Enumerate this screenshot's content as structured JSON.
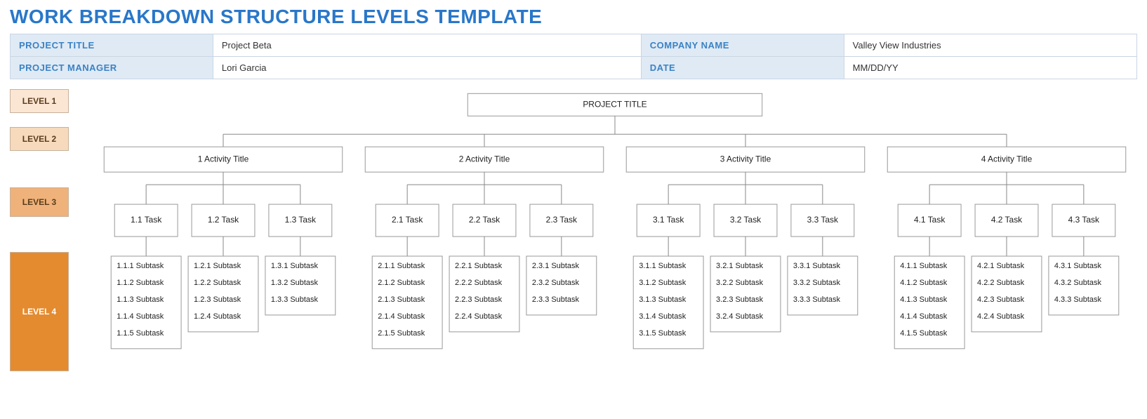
{
  "title": "WORK BREAKDOWN STRUCTURE LEVELS TEMPLATE",
  "info": {
    "project_title_label": "PROJECT TITLE",
    "project_title_value": "Project Beta",
    "company_name_label": "COMPANY NAME",
    "company_name_value": "Valley View Industries",
    "project_manager_label": "PROJECT MANAGER",
    "project_manager_value": "Lori Garcia",
    "date_label": "DATE",
    "date_value": "MM/DD/YY"
  },
  "levels": {
    "l1": "LEVEL 1",
    "l2": "LEVEL 2",
    "l3": "LEVEL 3",
    "l4": "LEVEL 4"
  },
  "root": "PROJECT TITLE",
  "activities": [
    {
      "label": "1 Activity Title",
      "tasks": [
        {
          "label": "1.1 Task",
          "subs": [
            "1.1.1 Subtask",
            "1.1.2 Subtask",
            "1.1.3 Subtask",
            "1.1.4 Subtask",
            "1.1.5 Subtask"
          ]
        },
        {
          "label": "1.2 Task",
          "subs": [
            "1.2.1 Subtask",
            "1.2.2 Subtask",
            "1.2.3 Subtask",
            "1.2.4 Subtask"
          ]
        },
        {
          "label": "1.3 Task",
          "subs": [
            "1.3.1 Subtask",
            "1.3.2 Subtask",
            "1.3.3 Subtask"
          ]
        }
      ]
    },
    {
      "label": "2 Activity Title",
      "tasks": [
        {
          "label": "2.1 Task",
          "subs": [
            "2.1.1 Subtask",
            "2.1.2 Subtask",
            "2.1.3 Subtask",
            "2.1.4 Subtask",
            "2.1.5 Subtask"
          ]
        },
        {
          "label": "2.2 Task",
          "subs": [
            "2.2.1 Subtask",
            "2.2.2 Subtask",
            "2.2.3 Subtask",
            "2.2.4 Subtask"
          ]
        },
        {
          "label": "2.3 Task",
          "subs": [
            "2.3.1 Subtask",
            "2.3.2 Subtask",
            "2.3.3 Subtask"
          ]
        }
      ]
    },
    {
      "label": "3 Activity Title",
      "tasks": [
        {
          "label": "3.1 Task",
          "subs": [
            "3.1.1 Subtask",
            "3.1.2 Subtask",
            "3.1.3 Subtask",
            "3.1.4 Subtask",
            "3.1.5 Subtask"
          ]
        },
        {
          "label": "3.2 Task",
          "subs": [
            "3.2.1 Subtask",
            "3.2.2 Subtask",
            "3.2.3 Subtask",
            "3.2.4 Subtask"
          ]
        },
        {
          "label": "3.3 Task",
          "subs": [
            "3.3.1 Subtask",
            "3.3.2 Subtask",
            "3.3.3 Subtask"
          ]
        }
      ]
    },
    {
      "label": "4 Activity Title",
      "tasks": [
        {
          "label": "4.1 Task",
          "subs": [
            "4.1.1 Subtask",
            "4.1.2 Subtask",
            "4.1.3 Subtask",
            "4.1.4 Subtask",
            "4.1.5 Subtask"
          ]
        },
        {
          "label": "4.2 Task",
          "subs": [
            "4.2.1 Subtask",
            "4.2.2 Subtask",
            "4.2.3 Subtask",
            "4.2.4 Subtask"
          ]
        },
        {
          "label": "4.3 Task",
          "subs": [
            "4.3.1 Subtask",
            "4.3.2 Subtask",
            "4.3.3 Subtask"
          ]
        }
      ]
    }
  ],
  "chart_data": {
    "type": "tree",
    "levels": [
      "Project",
      "Activity",
      "Task",
      "Subtask"
    ],
    "root": "PROJECT TITLE",
    "children": [
      {
        "label": "1 Activity Title",
        "children": [
          {
            "label": "1.1 Task",
            "children": [
              "1.1.1 Subtask",
              "1.1.2 Subtask",
              "1.1.3 Subtask",
              "1.1.4 Subtask",
              "1.1.5 Subtask"
            ]
          },
          {
            "label": "1.2 Task",
            "children": [
              "1.2.1 Subtask",
              "1.2.2 Subtask",
              "1.2.3 Subtask",
              "1.2.4 Subtask"
            ]
          },
          {
            "label": "1.3 Task",
            "children": [
              "1.3.1 Subtask",
              "1.3.2 Subtask",
              "1.3.3 Subtask"
            ]
          }
        ]
      },
      {
        "label": "2 Activity Title",
        "children": [
          {
            "label": "2.1 Task",
            "children": [
              "2.1.1 Subtask",
              "2.1.2 Subtask",
              "2.1.3 Subtask",
              "2.1.4 Subtask",
              "2.1.5 Subtask"
            ]
          },
          {
            "label": "2.2 Task",
            "children": [
              "2.2.1 Subtask",
              "2.2.2 Subtask",
              "2.2.3 Subtask",
              "2.2.4 Subtask"
            ]
          },
          {
            "label": "2.3 Task",
            "children": [
              "2.3.1 Subtask",
              "2.3.2 Subtask",
              "2.3.3 Subtask"
            ]
          }
        ]
      },
      {
        "label": "3 Activity Title",
        "children": [
          {
            "label": "3.1 Task",
            "children": [
              "3.1.1 Subtask",
              "3.1.2 Subtask",
              "3.1.3 Subtask",
              "3.1.4 Subtask",
              "3.1.5 Subtask"
            ]
          },
          {
            "label": "3.2 Task",
            "children": [
              "3.2.1 Subtask",
              "3.2.2 Subtask",
              "3.2.3 Subtask",
              "3.2.4 Subtask"
            ]
          },
          {
            "label": "3.3 Task",
            "children": [
              "3.3.1 Subtask",
              "3.3.2 Subtask",
              "3.3.3 Subtask"
            ]
          }
        ]
      },
      {
        "label": "4 Activity Title",
        "children": [
          {
            "label": "4.1 Task",
            "children": [
              "4.1.1 Subtask",
              "4.1.2 Subtask",
              "4.1.3 Subtask",
              "4.1.4 Subtask",
              "4.1.5 Subtask"
            ]
          },
          {
            "label": "4.2 Task",
            "children": [
              "4.2.1 Subtask",
              "4.2.2 Subtask",
              "4.2.3 Subtask",
              "4.2.4 Subtask"
            ]
          },
          {
            "label": "4.3 Task",
            "children": [
              "4.3.1 Subtask",
              "4.3.2 Subtask",
              "4.3.3 Subtask"
            ]
          }
        ]
      }
    ]
  }
}
